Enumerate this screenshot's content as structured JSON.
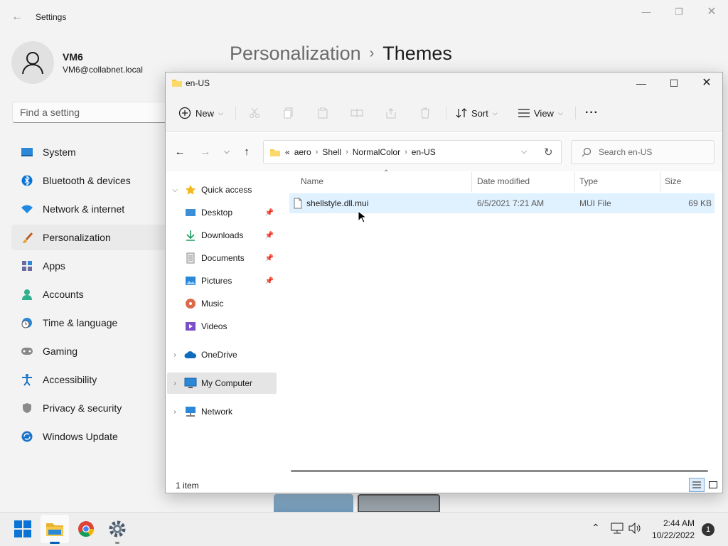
{
  "settings": {
    "title": "Settings",
    "user": {
      "name": "VM6",
      "email": "VM6@collabnet.local"
    },
    "search_placeholder": "Find a setting",
    "nav": [
      {
        "label": "System",
        "icon": "monitor-icon"
      },
      {
        "label": "Bluetooth & devices",
        "icon": "bluetooth-icon"
      },
      {
        "label": "Network & internet",
        "icon": "wifi-icon"
      },
      {
        "label": "Personalization",
        "icon": "brush-icon",
        "active": true
      },
      {
        "label": "Apps",
        "icon": "apps-icon"
      },
      {
        "label": "Accounts",
        "icon": "person-icon"
      },
      {
        "label": "Time & language",
        "icon": "clock-globe-icon"
      },
      {
        "label": "Gaming",
        "icon": "gamepad-icon"
      },
      {
        "label": "Accessibility",
        "icon": "accessibility-icon"
      },
      {
        "label": "Privacy & security",
        "icon": "shield-icon"
      },
      {
        "label": "Windows Update",
        "icon": "update-icon"
      }
    ],
    "breadcrumb": {
      "parent": "Personalization",
      "separator": "›",
      "current": "Themes"
    }
  },
  "explorer": {
    "title": "en-US",
    "toolbar": {
      "new_label": "New",
      "sort_label": "Sort",
      "view_label": "View",
      "more_label": "···"
    },
    "address": {
      "overflow": "«",
      "segments": [
        "aero",
        "Shell",
        "NormalColor",
        "en-US"
      ]
    },
    "search_placeholder": "Search en-US",
    "navpane": {
      "quick_access": "Quick access",
      "quick_items": [
        {
          "label": "Desktop",
          "pinned": true
        },
        {
          "label": "Downloads",
          "pinned": true
        },
        {
          "label": "Documents",
          "pinned": true
        },
        {
          "label": "Pictures",
          "pinned": true
        },
        {
          "label": "Music",
          "pinned": false
        },
        {
          "label": "Videos",
          "pinned": false
        }
      ],
      "onedrive": "OneDrive",
      "my_computer": "My Computer",
      "network": "Network"
    },
    "columns": {
      "name": "Name",
      "date": "Date modified",
      "type": "Type",
      "size": "Size"
    },
    "files": [
      {
        "name": "shellstyle.dll.mui",
        "date": "6/5/2021 7:21 AM",
        "type": "MUI File",
        "size": "69 KB"
      }
    ],
    "status": "1 item"
  },
  "taskbar": {
    "time": "2:44 AM",
    "date": "10/22/2022",
    "notifications": "1"
  },
  "colors": {
    "accent": "#005fb8",
    "selection": "#cce8ff",
    "folder": "#f8c948"
  }
}
